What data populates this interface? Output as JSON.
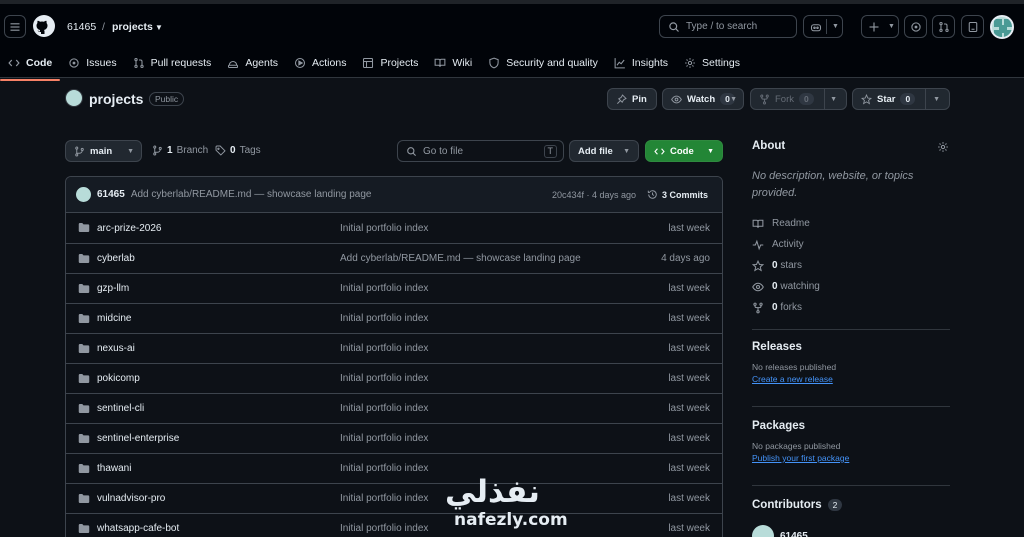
{
  "header": {
    "owner": "61465",
    "slash": "/",
    "repo": "projects",
    "search_placeholder": "Type / to search",
    "search_key": "/"
  },
  "tabs": [
    {
      "label": "Code",
      "icon": "code-icon"
    },
    {
      "label": "Issues",
      "icon": "issue-icon"
    },
    {
      "label": "Pull requests",
      "icon": "pull-request-icon"
    },
    {
      "label": "Agents",
      "icon": "agents-icon"
    },
    {
      "label": "Actions",
      "icon": "play-icon"
    },
    {
      "label": "Projects",
      "icon": "table-icon"
    },
    {
      "label": "Wiki",
      "icon": "book-icon"
    },
    {
      "label": "Security and quality",
      "icon": "shield-icon"
    },
    {
      "label": "Insights",
      "icon": "graph-icon"
    },
    {
      "label": "Settings",
      "icon": "gear-icon"
    }
  ],
  "repo": {
    "name": "projects",
    "visibility": "Public",
    "pin": "Pin",
    "watch": "Watch",
    "watch_count": "0",
    "fork": "Fork",
    "fork_count": "0",
    "star": "Star",
    "star_count": "0"
  },
  "toolbar": {
    "branch": "main",
    "branches_count": "1",
    "branches_label": "Branch",
    "tags_count": "0",
    "tags_label": "Tags",
    "goto_placeholder": "Go to file",
    "goto_key": "T",
    "add_file": "Add file",
    "code": "Code"
  },
  "latest_commit": {
    "user": "61465",
    "message": "Add cyberlab/README.md — showcase landing page",
    "meta": "20c434f · 4 days ago",
    "commits": "3 Commits"
  },
  "files": [
    {
      "name": "arc-prize-2026",
      "message": "Initial portfolio index",
      "date": "last week"
    },
    {
      "name": "cyberlab",
      "message": "Add cyberlab/README.md — showcase landing page",
      "date": "4 days ago"
    },
    {
      "name": "gzp-llm",
      "message": "Initial portfolio index",
      "date": "last week"
    },
    {
      "name": "midcine",
      "message": "Initial portfolio index",
      "date": "last week"
    },
    {
      "name": "nexus-ai",
      "message": "Initial portfolio index",
      "date": "last week"
    },
    {
      "name": "pokicomp",
      "message": "Initial portfolio index",
      "date": "last week"
    },
    {
      "name": "sentinel-cli",
      "message": "Initial portfolio index",
      "date": "last week"
    },
    {
      "name": "sentinel-enterprise",
      "message": "Initial portfolio index",
      "date": "last week"
    },
    {
      "name": "thawani",
      "message": "Initial portfolio index",
      "date": "last week"
    },
    {
      "name": "vulnadvisor-pro",
      "message": "Initial portfolio index",
      "date": "last week"
    },
    {
      "name": "whatsapp-cafe-bot",
      "message": "Initial portfolio index",
      "date": "last week"
    }
  ],
  "about": {
    "title": "About",
    "description": "No description, website, or topics provided.",
    "readme": "Readme",
    "activity": "Activity",
    "stars_count": "0",
    "stars_label": "stars",
    "watching_count": "0",
    "watching_label": "watching",
    "forks_count": "0",
    "forks_label": "forks"
  },
  "releases": {
    "title": "Releases",
    "note": "No releases published",
    "link": "Create a new release"
  },
  "packages": {
    "title": "Packages",
    "note": "No packages published",
    "link": "Publish your first package"
  },
  "contributors": {
    "title": "Contributors",
    "count": "2",
    "first": "61465"
  },
  "watermark": {
    "arabic": "نفذلي",
    "latin": "nafezly.com"
  }
}
